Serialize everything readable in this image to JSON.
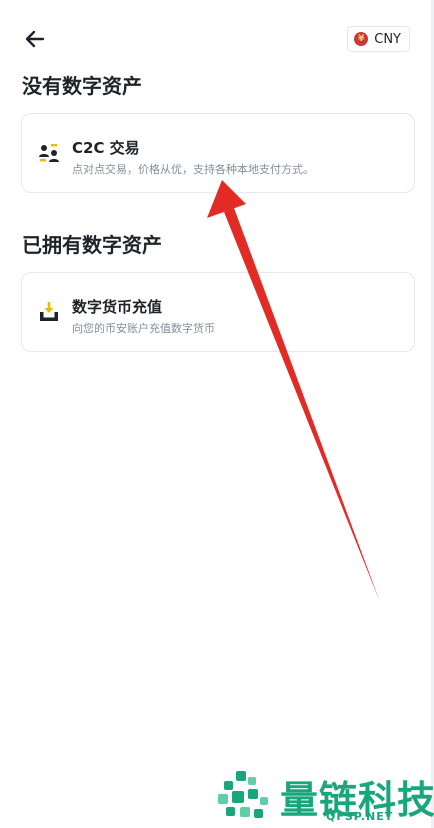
{
  "header": {
    "back_icon": "arrow-left-icon",
    "currency_label": "CNY",
    "currency_symbol": "¥",
    "currency_icon": "cny-flag-icon"
  },
  "section_no_assets": {
    "title": "没有数字资产",
    "card": {
      "icon": "p2p-users-icon",
      "title": "C2C 交易",
      "description": "点对点交易，价格从优，支持各种本地支付方式。"
    }
  },
  "section_has_assets": {
    "title": "已拥有数字资产",
    "card": {
      "icon": "deposit-tray-icon",
      "title": "数字货币充值",
      "description": "向您的币安账户充值数字货币"
    }
  },
  "annotation": {
    "icon": "red-arrow-annotation",
    "color": "#e32b26"
  },
  "watermark": {
    "name": "量链科技",
    "domain": "QFSP.NET",
    "color": "#18a67b"
  },
  "colors": {
    "accent": "#f0b90b",
    "text": "#1e2329",
    "muted": "#848e9c",
    "border": "#e6e8ea"
  }
}
